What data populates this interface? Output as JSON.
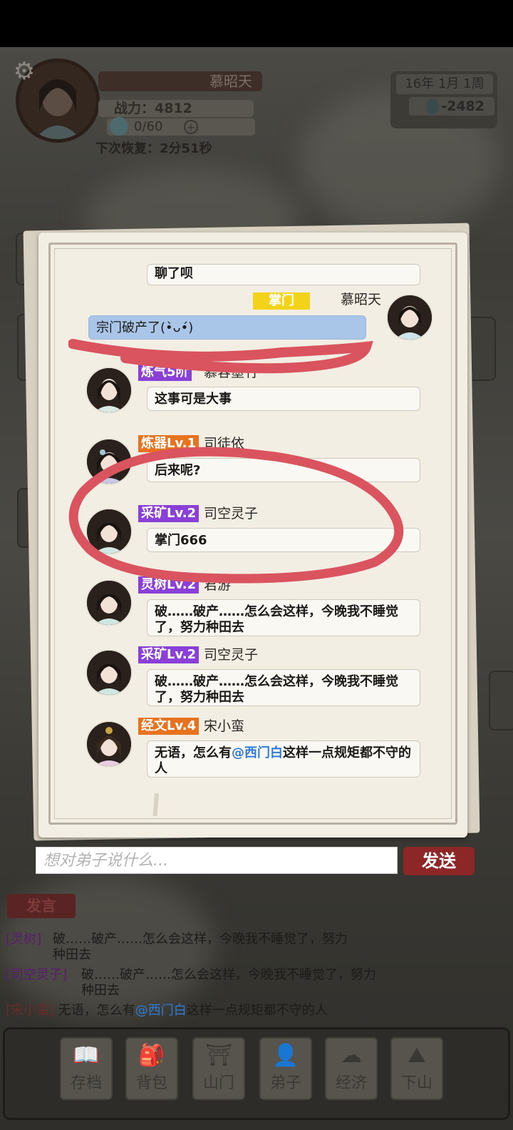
{
  "player": {
    "name": "慕昭天",
    "power": "战力：4812",
    "energy": "0/60",
    "recover": "下次恢复：2分51秒"
  },
  "calendar": {
    "date": "16年  1月  1周",
    "money": "-2482"
  },
  "chat": {
    "messages": [
      {
        "text": "聊了呗"
      },
      {
        "tag": "掌门",
        "name": "慕昭天",
        "text": "宗门破产了(•̀ᴗ•́)"
      },
      {
        "tag": "炼气5阶",
        "name": "慕容墨竹",
        "text": "这事可是大事"
      },
      {
        "tag": "炼器Lv.1",
        "name": "司徒依",
        "text": "后来呢?"
      },
      {
        "tag": "采矿Lv.2",
        "name": "司空灵子",
        "text": "掌门666"
      },
      {
        "tag": "灵树Lv.2",
        "name": "君游",
        "text": "破……破产……怎么会这样，今晚我不睡觉了，努力种田去"
      },
      {
        "tag": "采矿Lv.2",
        "name": "司空灵子",
        "text": "破……破产……怎么会这样，今晚我不睡觉了，努力种田去"
      },
      {
        "tag": "经文Lv.4",
        "name": "宋小蛮",
        "text_before": "无语，怎么有",
        "mention": "@西门白",
        "text_after": "这样一点规矩都不守的人"
      }
    ]
  },
  "input": {
    "placeholder": "想对弟子说什么...",
    "send": "发送"
  },
  "speak_button": "发言",
  "log": [
    {
      "who": "[灵树]",
      "text": "破……破产……怎么会这样，今晚我不睡觉了，努力种田去"
    },
    {
      "who": "[司空灵子]",
      "text": "破……破产……怎么会这样，今晚我不睡觉了，努力种田去"
    },
    {
      "who": "[宋小蛮]",
      "text_before": "无语，怎么有",
      "mention": "@西门白",
      "text_after": "这样一点规矩都不守的人"
    }
  ],
  "nav": [
    {
      "label": "存档",
      "icon": "book-icon"
    },
    {
      "label": "背包",
      "icon": "bag-icon"
    },
    {
      "label": "山门",
      "icon": "gate-icon"
    },
    {
      "label": "弟子",
      "icon": "disciple-icon"
    },
    {
      "label": "经济",
      "icon": "economy-icon"
    },
    {
      "label": "下山",
      "icon": "mountain-icon"
    }
  ],
  "colors": {
    "send_button": "#8d2626",
    "tag_purple": "#8a3fd6",
    "tag_orange": "#e8731f",
    "tag_yellow": "#f2d31a",
    "self_bubble": "#a9c6e8",
    "mention": "#2f7cd8",
    "annotation_red": "#d9545e"
  }
}
